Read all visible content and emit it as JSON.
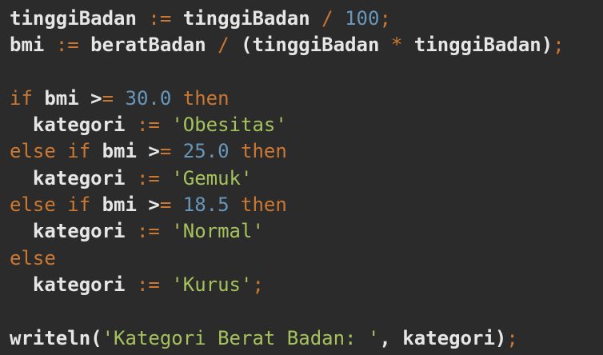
{
  "colors": {
    "background": "#2b2b2b",
    "identifier": "#e6e6e6",
    "keyword_operator": "#cc7832",
    "number": "#6897bb",
    "string": "#a5c25c"
  },
  "code_lines": [
    {
      "tokens": [
        {
          "t": "id",
          "v": "tinggiBadan"
        },
        {
          "t": "ws",
          "v": " "
        },
        {
          "t": "op",
          "v": ":="
        },
        {
          "t": "ws",
          "v": " "
        },
        {
          "t": "id",
          "v": "tinggiBadan"
        },
        {
          "t": "ws",
          "v": " "
        },
        {
          "t": "op",
          "v": "/"
        },
        {
          "t": "ws",
          "v": " "
        },
        {
          "t": "num",
          "v": "100"
        },
        {
          "t": "op",
          "v": ";"
        }
      ]
    },
    {
      "tokens": [
        {
          "t": "id",
          "v": "bmi"
        },
        {
          "t": "ws",
          "v": " "
        },
        {
          "t": "op",
          "v": ":="
        },
        {
          "t": "ws",
          "v": " "
        },
        {
          "t": "id",
          "v": "beratBadan"
        },
        {
          "t": "ws",
          "v": " "
        },
        {
          "t": "op",
          "v": "/"
        },
        {
          "t": "ws",
          "v": " "
        },
        {
          "t": "pu",
          "v": "("
        },
        {
          "t": "id",
          "v": "tinggiBadan"
        },
        {
          "t": "ws",
          "v": " "
        },
        {
          "t": "op",
          "v": "*"
        },
        {
          "t": "ws",
          "v": " "
        },
        {
          "t": "id",
          "v": "tinggiBadan"
        },
        {
          "t": "pu",
          "v": ")"
        },
        {
          "t": "op",
          "v": ";"
        }
      ]
    },
    {
      "tokens": []
    },
    {
      "tokens": [
        {
          "t": "kw",
          "v": "if"
        },
        {
          "t": "ws",
          "v": " "
        },
        {
          "t": "id",
          "v": "bmi"
        },
        {
          "t": "ws",
          "v": " "
        },
        {
          "t": "pu",
          "v": ">"
        },
        {
          "t": "op",
          "v": "="
        },
        {
          "t": "ws",
          "v": " "
        },
        {
          "t": "num",
          "v": "30.0"
        },
        {
          "t": "ws",
          "v": " "
        },
        {
          "t": "kw",
          "v": "then"
        }
      ]
    },
    {
      "tokens": [
        {
          "t": "ws",
          "v": "  "
        },
        {
          "t": "id",
          "v": "kategori"
        },
        {
          "t": "ws",
          "v": " "
        },
        {
          "t": "op",
          "v": ":="
        },
        {
          "t": "ws",
          "v": " "
        },
        {
          "t": "str",
          "v": "'Obesitas'"
        }
      ]
    },
    {
      "tokens": [
        {
          "t": "kw",
          "v": "else"
        },
        {
          "t": "ws",
          "v": " "
        },
        {
          "t": "kw",
          "v": "if"
        },
        {
          "t": "ws",
          "v": " "
        },
        {
          "t": "id",
          "v": "bmi"
        },
        {
          "t": "ws",
          "v": " "
        },
        {
          "t": "pu",
          "v": ">"
        },
        {
          "t": "op",
          "v": "="
        },
        {
          "t": "ws",
          "v": " "
        },
        {
          "t": "num",
          "v": "25.0"
        },
        {
          "t": "ws",
          "v": " "
        },
        {
          "t": "kw",
          "v": "then"
        }
      ]
    },
    {
      "tokens": [
        {
          "t": "ws",
          "v": "  "
        },
        {
          "t": "id",
          "v": "kategori"
        },
        {
          "t": "ws",
          "v": " "
        },
        {
          "t": "op",
          "v": ":="
        },
        {
          "t": "ws",
          "v": " "
        },
        {
          "t": "str",
          "v": "'Gemuk'"
        }
      ]
    },
    {
      "tokens": [
        {
          "t": "kw",
          "v": "else"
        },
        {
          "t": "ws",
          "v": " "
        },
        {
          "t": "kw",
          "v": "if"
        },
        {
          "t": "ws",
          "v": " "
        },
        {
          "t": "id",
          "v": "bmi"
        },
        {
          "t": "ws",
          "v": " "
        },
        {
          "t": "pu",
          "v": ">"
        },
        {
          "t": "op",
          "v": "="
        },
        {
          "t": "ws",
          "v": " "
        },
        {
          "t": "num",
          "v": "18.5"
        },
        {
          "t": "ws",
          "v": " "
        },
        {
          "t": "kw",
          "v": "then"
        }
      ]
    },
    {
      "tokens": [
        {
          "t": "ws",
          "v": "  "
        },
        {
          "t": "id",
          "v": "kategori"
        },
        {
          "t": "ws",
          "v": " "
        },
        {
          "t": "op",
          "v": ":="
        },
        {
          "t": "ws",
          "v": " "
        },
        {
          "t": "str",
          "v": "'Normal'"
        }
      ]
    },
    {
      "tokens": [
        {
          "t": "kw",
          "v": "else"
        }
      ]
    },
    {
      "tokens": [
        {
          "t": "ws",
          "v": "  "
        },
        {
          "t": "id",
          "v": "kategori"
        },
        {
          "t": "ws",
          "v": " "
        },
        {
          "t": "op",
          "v": ":="
        },
        {
          "t": "ws",
          "v": " "
        },
        {
          "t": "str",
          "v": "'Kurus'"
        },
        {
          "t": "op",
          "v": ";"
        }
      ]
    },
    {
      "tokens": []
    },
    {
      "tokens": [
        {
          "t": "id",
          "v": "writeln"
        },
        {
          "t": "pu",
          "v": "("
        },
        {
          "t": "str",
          "v": "'Kategori Berat Badan: '"
        },
        {
          "t": "pu",
          "v": ","
        },
        {
          "t": "ws",
          "v": " "
        },
        {
          "t": "id",
          "v": "kategori"
        },
        {
          "t": "pu",
          "v": ")"
        },
        {
          "t": "op",
          "v": ";"
        }
      ]
    }
  ]
}
